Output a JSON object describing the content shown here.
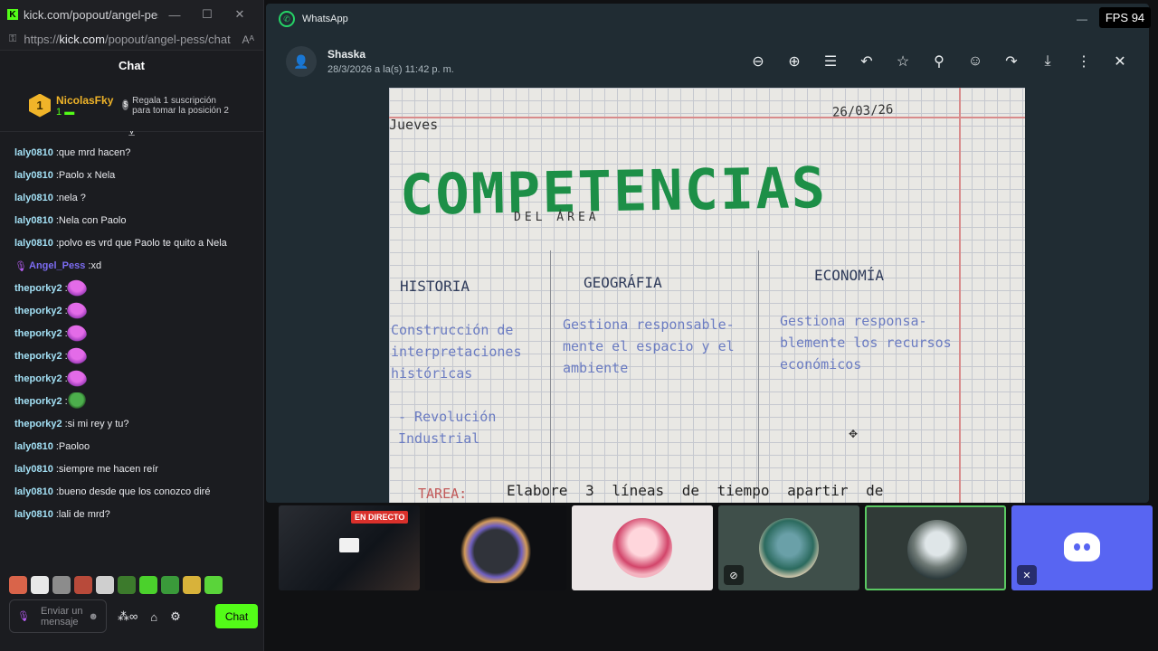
{
  "kick": {
    "window_title": "kick.com/popout/angel-pes…",
    "url_prefix": "https://",
    "url_domain": "kick.com",
    "url_path": "/popout/angel-pess/chat",
    "chat_title": "Chat",
    "pinned": {
      "rank": "1",
      "user": "NicolasFky",
      "count": "1",
      "gift_text": "Regala 1 suscripción para tomar la posición 2"
    },
    "messages": [
      {
        "user": "laly0810",
        "text": "que mrd hacen?"
      },
      {
        "user": "laly0810",
        "text": "Paolo x Nela"
      },
      {
        "user": "laly0810",
        "text": "nela ?"
      },
      {
        "user": "laly0810",
        "text": "Nela con Paolo"
      },
      {
        "user": "laly0810",
        "text": "polvo es vrd que Paolo te quito a Nela"
      },
      {
        "user": "Angel_Pess",
        "text": "xd"
      },
      {
        "user": "theporky2",
        "text": ""
      },
      {
        "user": "theporky2",
        "text": ""
      },
      {
        "user": "theporky2",
        "text": ""
      },
      {
        "user": "theporky2",
        "text": ""
      },
      {
        "user": "theporky2",
        "text": ""
      },
      {
        "user": "theporky2",
        "text": ""
      },
      {
        "user": "theporky2",
        "text": "si mi rey y tu?"
      },
      {
        "user": "laly0810",
        "text": "Paoloo"
      },
      {
        "user": "laly0810",
        "text": "siempre me hacen reír"
      },
      {
        "user": "laly0810",
        "text": "bueno desde que los conozco diré"
      },
      {
        "user": "laly0810",
        "text": "lali de mrd?"
      }
    ],
    "composer_placeholder": "Enviar un mensaje",
    "chat_button": "Chat",
    "infinity_label": "∞"
  },
  "whatsapp": {
    "app_title": "WhatsApp",
    "sender": "Shaska",
    "timestamp": "28/3/2026 a la(s) 11:42 p. m.",
    "notebook": {
      "day": "Jueves",
      "date": "26/03/26",
      "title": "COMPETENCIAS",
      "subtitle": "DEL ÁREA",
      "columns": [
        "HISTORIA",
        "GEOGRÁFIA",
        "ECONOMÍA"
      ],
      "col_texts": [
        "Construcción de interpretaciones históricas",
        "Gestiona responsable- mente el espacio y el ambiente",
        "Gestiona responsa- blemente los recursos económicos"
      ],
      "bullet": "- Revolución Industrial",
      "task_label": "TAREA:",
      "task_text": "Elabore 3 líneas de tiempo apartir de"
    }
  },
  "overlay": {
    "fps": "FPS 94",
    "live_badge": "EN DIRECTO"
  }
}
